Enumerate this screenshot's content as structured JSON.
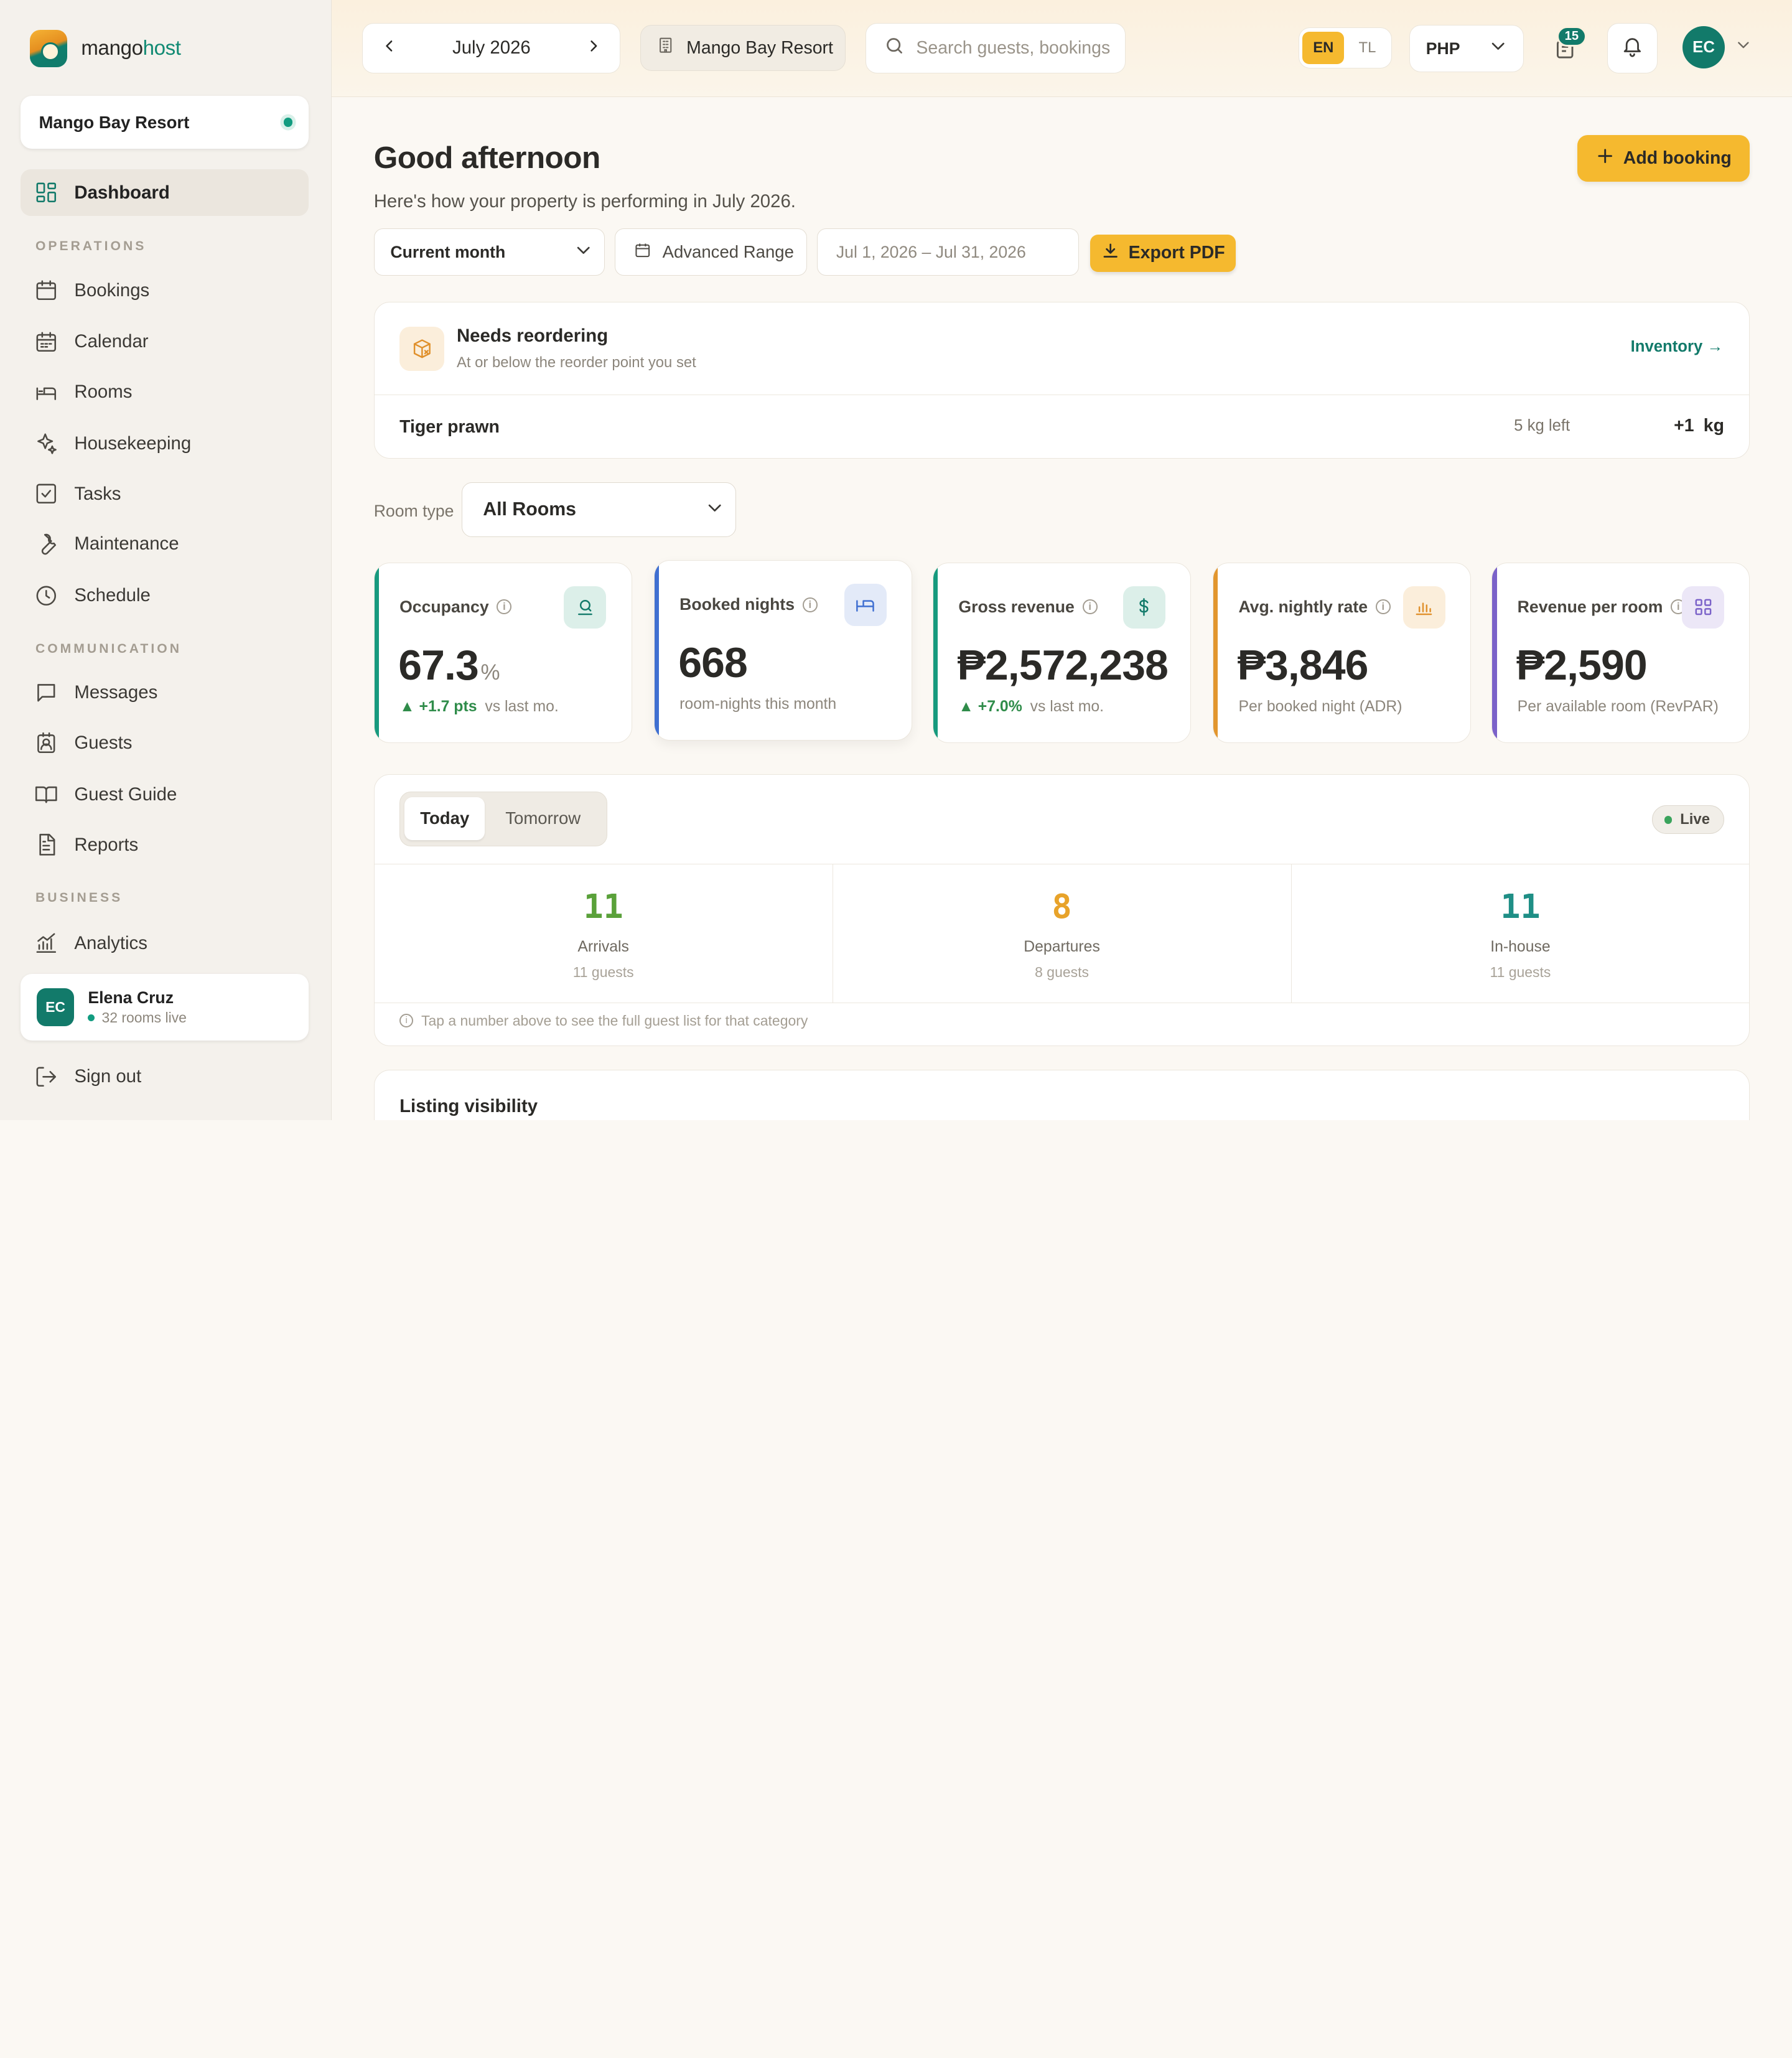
{
  "brand": {
    "name_main": "mango",
    "name_accent": "host"
  },
  "sidebar": {
    "property": "Mango Bay Resort",
    "active_item": "Dashboard",
    "sections": [
      {
        "label": "OPERATIONS",
        "items": [
          "Bookings",
          "Calendar",
          "Rooms",
          "Housekeeping",
          "Tasks",
          "Maintenance",
          "Schedule"
        ]
      },
      {
        "label": "COMMUNICATION",
        "items": [
          "Messages",
          "Guests",
          "Guest Guide",
          "Reports"
        ]
      },
      {
        "label": "BUSINESS",
        "items": [
          "Analytics"
        ]
      }
    ],
    "user": {
      "initials": "EC",
      "name": "Elena Cruz",
      "status": "32 rooms live"
    },
    "sign_out": "Sign out"
  },
  "topbar": {
    "month": "July 2026",
    "property": "Mango Bay Resort",
    "search_placeholder": "Search guests, bookings",
    "lang_options": [
      "EN",
      "TL"
    ],
    "lang_selected": "EN",
    "currency": "PHP",
    "notification_count": "15",
    "avatar_initials": "EC"
  },
  "header": {
    "greeting": "Good afternoon",
    "subtitle": "Here's how your property is performing in July 2026.",
    "add_booking": "Add booking"
  },
  "filters": {
    "period": "Current month",
    "advanced": "Advanced Range",
    "dates": "Jul 1, 2026 – Jul 31, 2026",
    "export": "Export PDF"
  },
  "reorder": {
    "title": "Needs reordering",
    "subtitle": "At or below the reorder point you set",
    "link": "Inventory",
    "item": {
      "name": "Tiger prawn",
      "left": "5 kg left",
      "qty": "+1 kg"
    }
  },
  "room_type": {
    "label": "Room type",
    "value": "All Rooms"
  },
  "kpis": [
    {
      "title": "Occupancy",
      "value": "67.3",
      "unit": "%",
      "delta": "▲ +1.7 pts",
      "foot": "vs last mo.",
      "accent": "#179a7e",
      "icon_bg": "#dcefe9",
      "icon_stroke": "#127a6a"
    },
    {
      "title": "Booked nights",
      "value": "668",
      "unit": "",
      "delta": "",
      "foot": "room-nights this month",
      "accent": "#3f6fd1",
      "icon_bg": "#e3eaf8",
      "icon_stroke": "#3f6fd1"
    },
    {
      "title": "Gross revenue",
      "value": "₱2,572,238",
      "unit": "",
      "delta": "▲ +7.0%",
      "foot": "vs last mo.",
      "accent": "#179a7e",
      "icon_bg": "#dcefe9",
      "icon_stroke": "#127a6a"
    },
    {
      "title": "Avg. nightly rate",
      "value": "₱3,846",
      "unit": "",
      "delta": "",
      "foot": "Per booked night (ADR)",
      "accent": "#e2962e",
      "icon_bg": "#fbeedb",
      "icon_stroke": "#e0902b"
    },
    {
      "title": "Revenue per room",
      "value": "₱2,590",
      "unit": "",
      "delta": "",
      "foot": "Per available room (RevPAR)",
      "accent": "#7b62c9",
      "icon_bg": "#ece7f7",
      "icon_stroke": "#7b62c9"
    }
  ],
  "today": {
    "tabs": [
      "Today",
      "Tomorrow"
    ],
    "live": "Live",
    "stats": [
      {
        "value": "11",
        "label": "Arrivals",
        "sub": "11 guests",
        "color": "#5aa13a"
      },
      {
        "value": "8",
        "label": "Departures",
        "sub": "8 guests",
        "color": "#e8a32a"
      },
      {
        "value": "11",
        "label": "In-house",
        "sub": "11 guests",
        "color": "#1f8f86"
      }
    ],
    "hint": "Tap a number above to see the full guest list for that category"
  },
  "listing": {
    "title": "Listing visibility"
  }
}
